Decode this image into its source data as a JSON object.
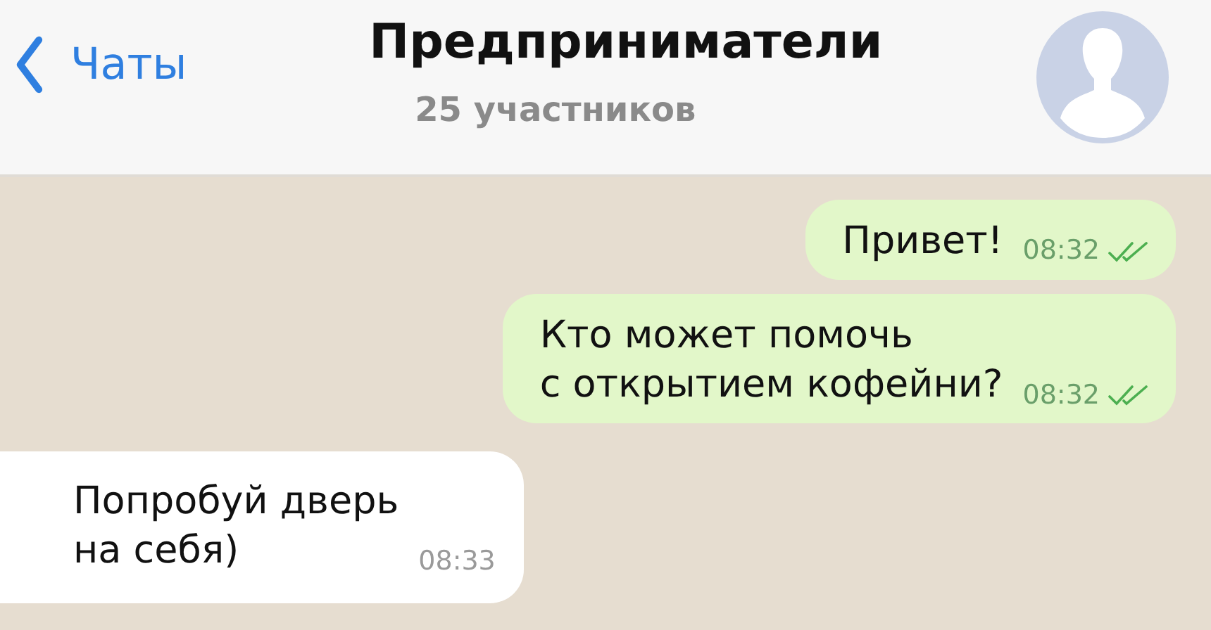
{
  "header": {
    "back_label": "Чаты",
    "title": "Предприниматели",
    "subtitle": "25 участников"
  },
  "messages": [
    {
      "kind": "outgoing",
      "text": "Привет!",
      "time": "08:32",
      "read": true
    },
    {
      "kind": "outgoing",
      "text": "Кто может помочь\nс открытием кофейни?",
      "time": "08:32",
      "read": true
    },
    {
      "kind": "incoming",
      "text": "Попробуй дверь\nна себя)",
      "time": "08:33"
    }
  ]
}
